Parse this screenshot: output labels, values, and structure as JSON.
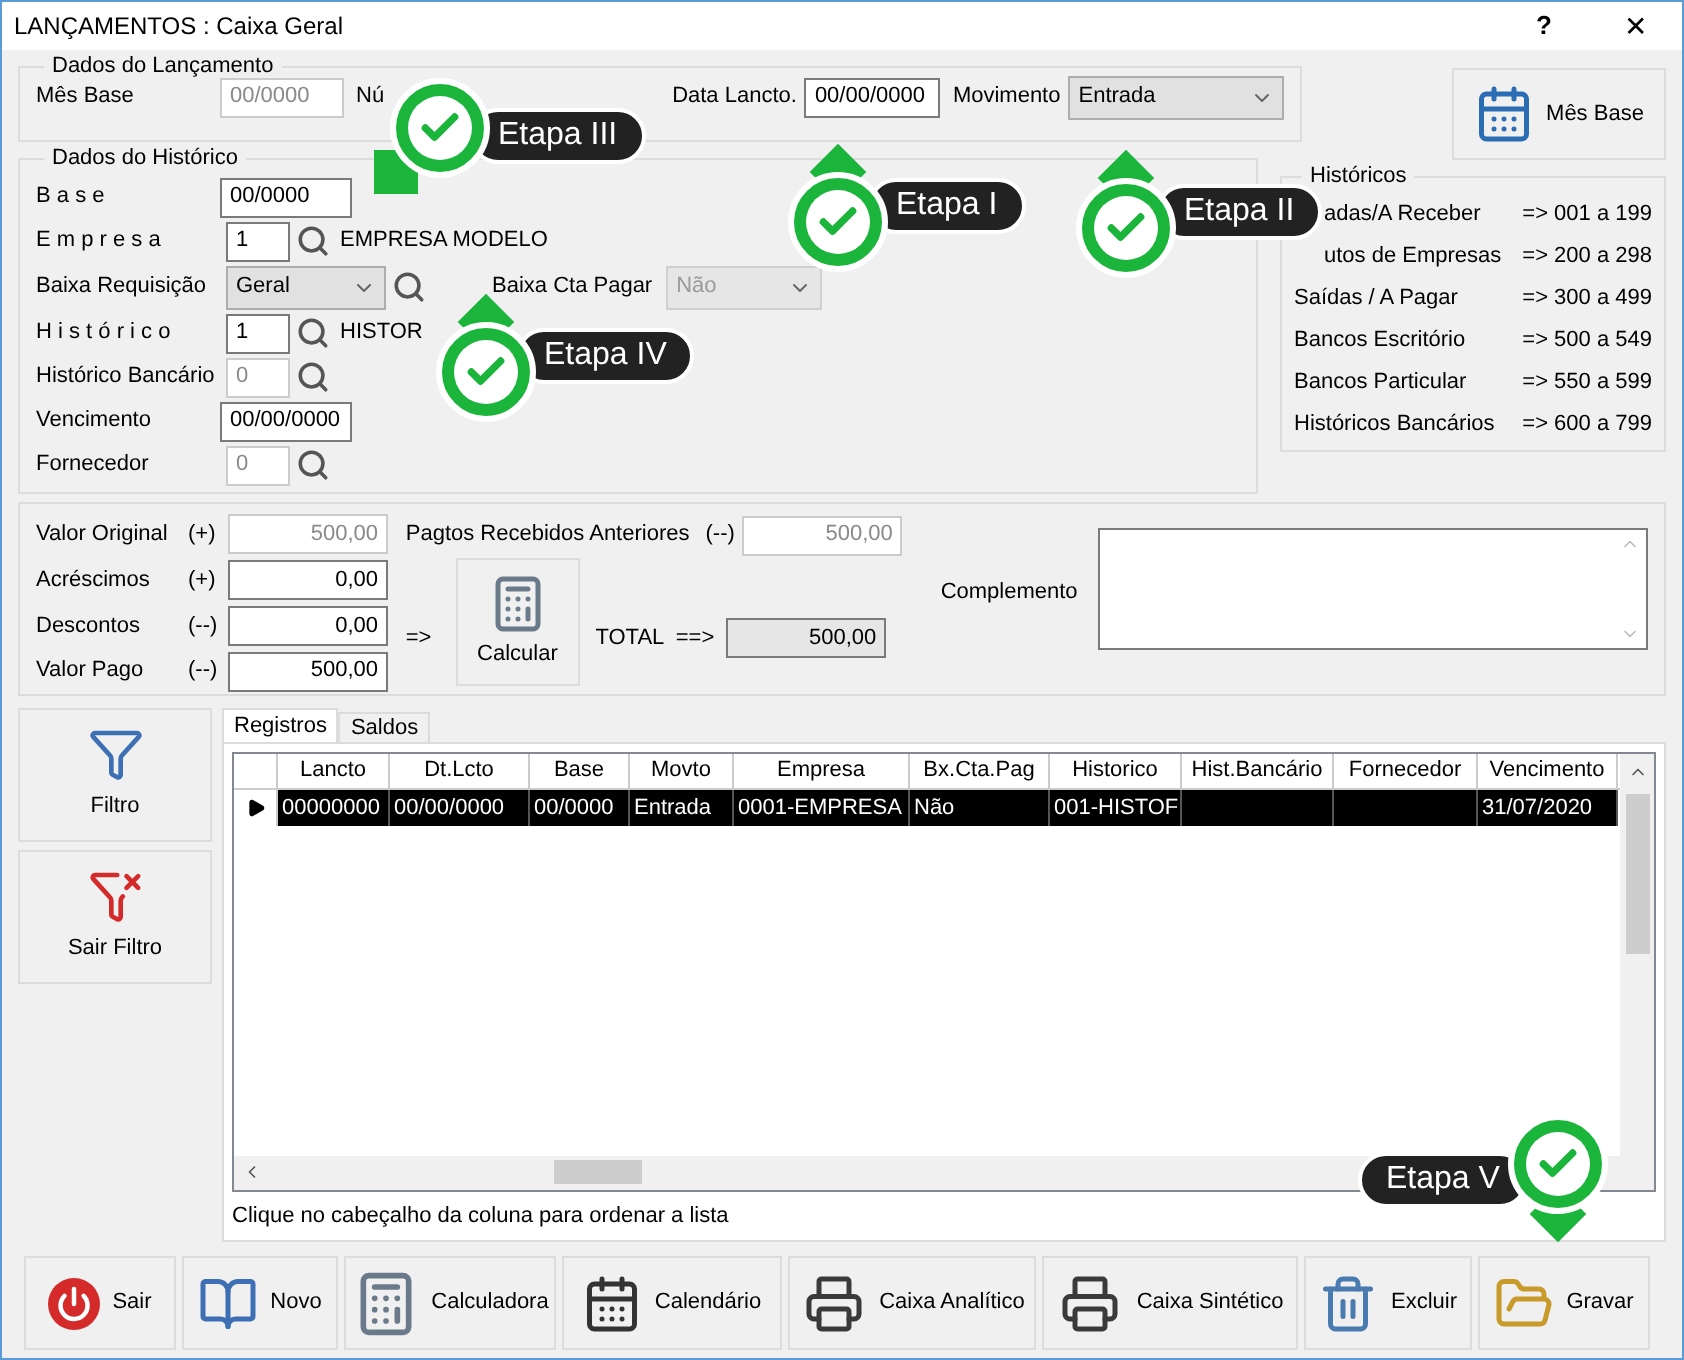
{
  "window": {
    "title": "LANÇAMENTOS : Caixa Geral",
    "help": "?",
    "close": "✕"
  },
  "lancamento": {
    "legend": "Dados do Lançamento",
    "mes_base_label": "Mês Base",
    "mes_base_value": "00/0000",
    "numero_label": "Nú",
    "data_label": "Data Lancto.",
    "data_value": "00/00/0000",
    "movimento_label": "Movimento",
    "movimento_value": "Entrada"
  },
  "historico": {
    "legend": "Dados do Histórico",
    "rows": [
      {
        "kind": "input",
        "label": "B a s e",
        "value": "00/0000",
        "disabled": false
      },
      {
        "kind": "lookup",
        "label": "E m p r e s a",
        "value": "1",
        "disabled": false,
        "text": "EMPRESA MODELO"
      },
      {
        "kind": "select",
        "label": "Baixa Requisição",
        "value": "Geral",
        "extra_label": "Baixa Cta Pagar",
        "extra_value": "Não"
      },
      {
        "kind": "lookup",
        "label": "H i s t ó r i c o",
        "value": "1",
        "disabled": false,
        "text": "HISTOR"
      },
      {
        "kind": "lookup",
        "label": "Histórico Bancário",
        "value": "0",
        "disabled": true
      },
      {
        "kind": "input",
        "label": "Vencimento",
        "value": "00/00/0000",
        "disabled": false
      },
      {
        "kind": "lookup",
        "label": "Fornecedor",
        "value": "0",
        "disabled": true
      }
    ]
  },
  "mes_base_button": "Mês Base",
  "historicos": {
    "legend": "Históricos",
    "items": [
      {
        "name": "adas/A Receber",
        "range": "=> 001 a 199",
        "clipped": true
      },
      {
        "name": "utos de Empresas",
        "range": "=> 200 a 298",
        "clipped": true
      },
      {
        "name": "Saídas / A Pagar",
        "range": "=> 300 a 499",
        "clipped": false
      },
      {
        "name": "Bancos Escritório",
        "range": "=> 500 a 549",
        "clipped": false
      },
      {
        "name": "Bancos Particular",
        "range": "=> 550 a 599",
        "clipped": false
      },
      {
        "name": "Históricos Bancários",
        "range": "=> 600 a 799",
        "clipped": false
      }
    ]
  },
  "valores": {
    "rows": [
      {
        "label": "Valor Original",
        "sign": "(+)",
        "value": "500,00",
        "disabled": true
      },
      {
        "label": "Acréscimos",
        "sign": "(+)",
        "value": "0,00",
        "disabled": false
      },
      {
        "label": "Descontos",
        "sign": "(--)",
        "value": "0,00",
        "disabled": false
      },
      {
        "label": "Valor Pago",
        "sign": "(--)",
        "value": "500,00",
        "disabled": false
      }
    ],
    "anteriores_label": "Pagtos Recebidos Anteriores",
    "anteriores_sign": "(--)",
    "anteriores_value": "500,00",
    "arrow": "=>",
    "calcular": "Calcular",
    "total_label": "TOTAL  ==>",
    "total_value": "500,00",
    "complemento_label": "Complemento"
  },
  "side_buttons": [
    {
      "kind": "filter",
      "label": "Filtro"
    },
    {
      "kind": "clear",
      "label": "Sair Filtro"
    }
  ],
  "tabs": [
    {
      "label": "Registros",
      "selected": true
    },
    {
      "label": "Saldos",
      "selected": false
    }
  ],
  "table": {
    "columns": [
      "Lancto",
      "Dt.Lcto",
      "Base",
      "Movto",
      "Empresa",
      "Bx.Cta.Pag",
      "Historico",
      "Hist.Bancário",
      "Fornecedor",
      "Vencimento"
    ],
    "rows": [
      {
        "selected": true,
        "cells": [
          "00000000",
          "00/00/0000",
          "00/0000",
          "Entrada",
          "0001-EMPRESA",
          "Não",
          "001-HISTOF",
          "",
          "",
          "31/07/2020"
        ]
      }
    ]
  },
  "hint": "Clique no cabeçalho da coluna para ordenar a lista",
  "toolbar": [
    {
      "kind": "power",
      "label": "Sair"
    },
    {
      "kind": "book",
      "label": "Novo"
    },
    {
      "kind": "calculator",
      "label": "Calculadora"
    },
    {
      "kind": "calendar",
      "label": "Calendário"
    },
    {
      "kind": "printer",
      "label": "Caixa Analítico"
    },
    {
      "kind": "printer",
      "label": "Caixa Sintético"
    },
    {
      "kind": "trash",
      "label": "Excluir"
    },
    {
      "kind": "folder",
      "label": "Gravar"
    }
  ],
  "callouts": [
    {
      "label": "Etapa III",
      "kind": "left"
    },
    {
      "label": "Etapa I",
      "kind": "up"
    },
    {
      "label": "Etapa II",
      "kind": "up"
    },
    {
      "label": "Etapa IV",
      "kind": "up"
    },
    {
      "label": "Etapa V",
      "kind": "down"
    }
  ]
}
